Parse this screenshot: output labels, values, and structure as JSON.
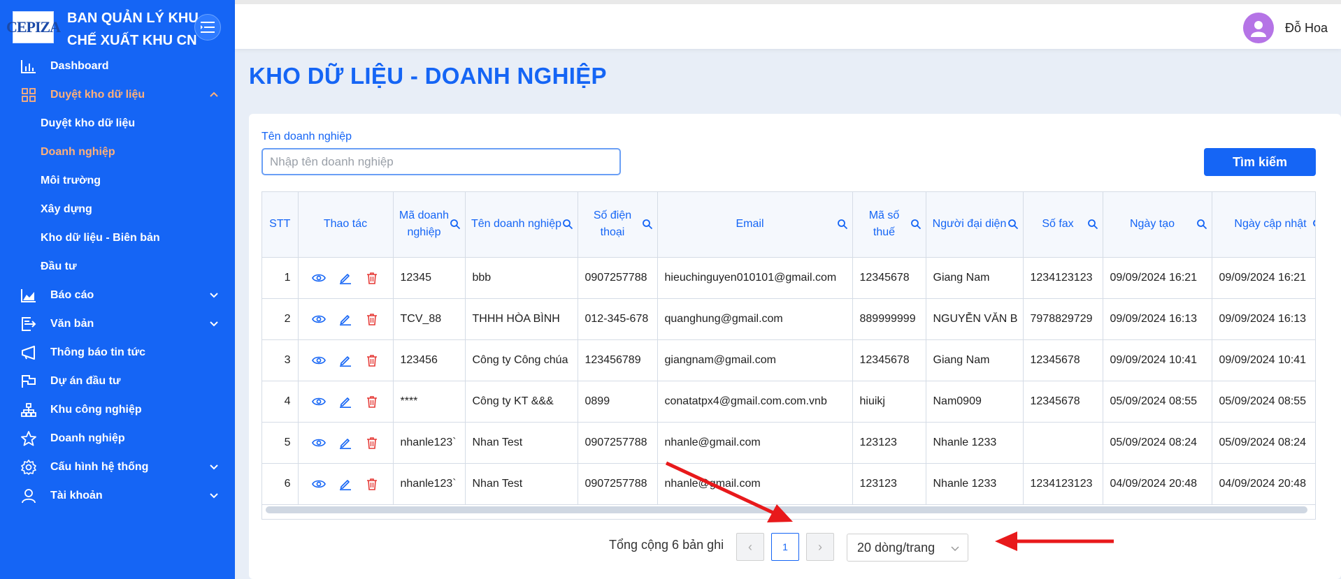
{
  "brand": {
    "logo_text": "CEPIZA",
    "org_name_line1": "BAN QUẢN LÝ KHU",
    "org_name_line2": "CHẾ XUẤT KHU CN"
  },
  "sidebar": {
    "items": [
      {
        "label": "Dashboard",
        "icon": "bar-chart-icon"
      },
      {
        "label": "Duyệt kho dữ liệu",
        "icon": "grid-icon",
        "expanded": true
      },
      {
        "label": "Báo cáo",
        "icon": "area-chart-icon"
      },
      {
        "label": "Văn bản",
        "icon": "document-export-icon"
      },
      {
        "label": "Thông báo tin tức",
        "icon": "megaphone-icon"
      },
      {
        "label": "Dự án đầu tư",
        "icon": "flag-icon"
      },
      {
        "label": "Khu công nghiệp",
        "icon": "sitemap-icon"
      },
      {
        "label": "Doanh nghiệp",
        "icon": "star-icon"
      },
      {
        "label": "Cấu hình hệ thống",
        "icon": "gear-icon"
      },
      {
        "label": "Tài khoản",
        "icon": "user-icon"
      }
    ],
    "subitems": [
      {
        "label": "Duyệt kho dữ liệu"
      },
      {
        "label": "Doanh nghiệp"
      },
      {
        "label": "Môi trường"
      },
      {
        "label": "Xây dựng"
      },
      {
        "label": "Kho dữ liệu - Biên bản"
      },
      {
        "label": "Đầu tư"
      }
    ]
  },
  "header": {
    "username": "Đỗ Hoa"
  },
  "page": {
    "title": "KHO DỮ LIỆU - DOANH NGHIỆP"
  },
  "search": {
    "label": "Tên doanh nghiệp",
    "placeholder": "Nhập tên doanh nghiệp",
    "value": "",
    "button": "Tìm kiếm"
  },
  "table": {
    "columns": [
      "STT",
      "Thao tác",
      "Mã doanh nghiệp",
      "Tên doanh nghiệp",
      "Số điện thoại",
      "Email",
      "Mã số thuế",
      "Người đại diện",
      "Số fax",
      "Ngày tạo",
      "Ngày cập nhật"
    ],
    "rows": [
      [
        "1",
        "12345",
        "bbb",
        "0907257788",
        "hieuchinguyen010101@gmail.com",
        "12345678",
        "Giang Nam",
        "1234123123",
        "09/09/2024 16:21",
        "09/09/2024 16:21"
      ],
      [
        "2",
        "TCV_88",
        "THHH HÒA BÌNH",
        "012-345-678",
        "quanghung@gmail.com",
        "889999999",
        "NGUYỄN VĂN B",
        "7978829729",
        "09/09/2024 16:13",
        "09/09/2024 16:13"
      ],
      [
        "3",
        "123456",
        "Công ty Công chúa",
        "123456789",
        "giangnam@gmail.com",
        "12345678",
        "Giang Nam",
        "12345678",
        "09/09/2024 10:41",
        "09/09/2024 10:41"
      ],
      [
        "4",
        "****",
        "Công ty KT &&&",
        "0899",
        "conatatpx4@gmail.com.com.vnb",
        "hiuikj",
        "Nam0909",
        "12345678",
        "05/09/2024 08:55",
        "05/09/2024 08:55"
      ],
      [
        "5",
        "nhanle123`",
        "Nhan Test",
        "0907257788",
        "nhanle@gmail.com",
        "123123",
        "Nhanle 1233",
        "",
        "05/09/2024 08:24",
        "05/09/2024 08:24"
      ],
      [
        "6",
        "nhanle123`",
        "Nhan Test",
        "0907257788",
        "nhanle@gmail.com",
        "123123",
        "Nhanle 1233",
        "1234123123",
        "04/09/2024 20:48",
        "04/09/2024 20:48"
      ]
    ]
  },
  "pagination": {
    "total_text": "Tổng cộng 6 bản ghi",
    "current_page": "1",
    "page_size": "20 dòng/trang"
  },
  "colors": {
    "primary": "#1565f5",
    "active_menu": "#ffb07a",
    "delete": "#e53935",
    "arrow": "#e8191b"
  }
}
